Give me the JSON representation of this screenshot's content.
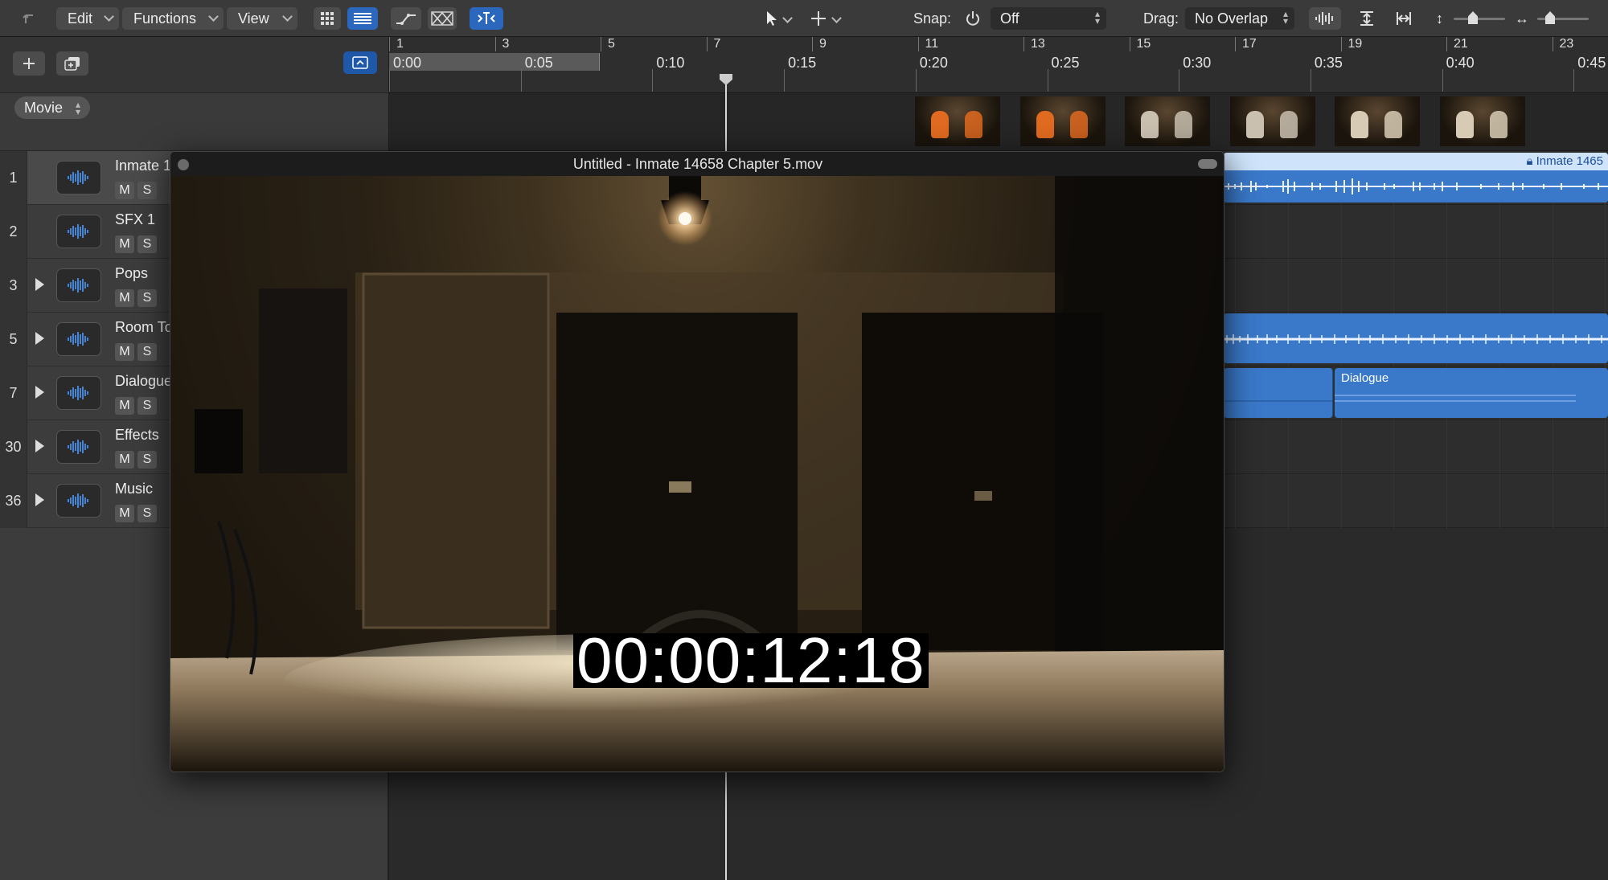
{
  "toolbar": {
    "menus": [
      {
        "label": "Edit"
      },
      {
        "label": "Functions"
      },
      {
        "label": "View"
      }
    ],
    "snap_label": "Snap:",
    "snap_value": "Off",
    "drag_label": "Drag:",
    "drag_value": "No Overlap"
  },
  "global": {
    "movie_label": "Movie"
  },
  "ruler": {
    "bars": [
      "1",
      "3",
      "5",
      "7",
      "9",
      "11",
      "13",
      "15",
      "17",
      "19",
      "21",
      "23"
    ],
    "times": [
      "0:00",
      "0:05",
      "0:10",
      "0:15",
      "0:20",
      "0:25",
      "0:30",
      "0:35",
      "0:40",
      "0:45"
    ]
  },
  "tracks": [
    {
      "number": "1",
      "name": "Inmate 1",
      "mute": "M",
      "solo": "S",
      "has_disclosure": false,
      "selected": true
    },
    {
      "number": "2",
      "name": "SFX 1",
      "mute": "M",
      "solo": "S",
      "has_disclosure": false,
      "selected": false
    },
    {
      "number": "3",
      "name": "Pops",
      "mute": "M",
      "solo": "S",
      "has_disclosure": true,
      "selected": false
    },
    {
      "number": "5",
      "name": "Room To",
      "mute": "M",
      "solo": "S",
      "has_disclosure": true,
      "selected": false
    },
    {
      "number": "7",
      "name": "Dialogue",
      "mute": "M",
      "solo": "S",
      "has_disclosure": true,
      "selected": false
    },
    {
      "number": "30",
      "name": "Effects",
      "mute": "M",
      "solo": "S",
      "has_disclosure": true,
      "selected": false
    },
    {
      "number": "36",
      "name": "Music",
      "mute": "M",
      "solo": "S",
      "has_disclosure": true,
      "selected": false
    }
  ],
  "regions": {
    "inmate_label": "Inmate 1465",
    "dialogue_label": "Dialogue"
  },
  "movie_window": {
    "title": "Untitled - Inmate 14658 Chapter 5.mov",
    "timecode": "00:00:12:18"
  },
  "colors": {
    "accent_blue": "#2b67bd",
    "region_blue": "#3a79c9",
    "region_light": "#cfe4fb"
  }
}
